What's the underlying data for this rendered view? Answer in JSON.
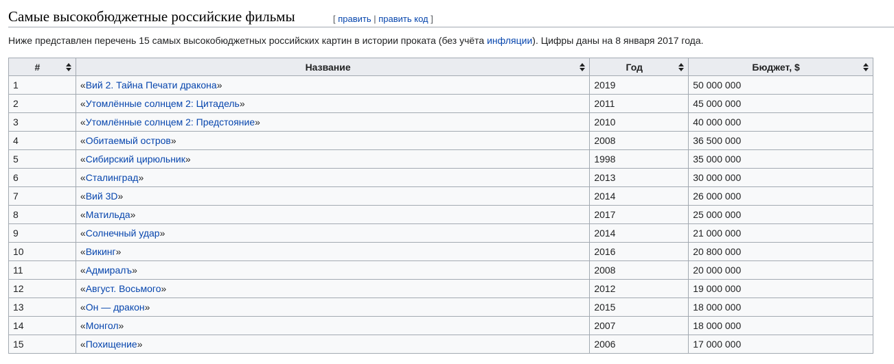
{
  "section": {
    "title": "Самые высокобюджетные российские фильмы",
    "edit_open": "[ ",
    "edit_link": "править",
    "edit_sep": " | ",
    "edit_code_link": "править код",
    "edit_close": " ]"
  },
  "intro": {
    "text_before": "Ниже представлен перечень 15 самых высокобюджетных российских картин в истории проката (без учёта ",
    "link": "инфляции",
    "text_after": "). Цифры даны на 8 января 2017 года."
  },
  "table": {
    "columns": [
      "#",
      "Название",
      "Год",
      "Бюджет, $"
    ],
    "quote_open": "«",
    "quote_close": "»",
    "rows": [
      {
        "num": "1",
        "title": "Вий 2. Тайна Печати дракона",
        "year": "2019",
        "budget": "50 000 000"
      },
      {
        "num": "2",
        "title": "Утомлённые солнцем 2: Цитадель",
        "year": "2011",
        "budget": "45 000 000"
      },
      {
        "num": "3",
        "title": "Утомлённые солнцем 2: Предстояние",
        "year": "2010",
        "budget": "40 000 000"
      },
      {
        "num": "4",
        "title": "Обитаемый остров",
        "year": "2008",
        "budget": "36 500 000"
      },
      {
        "num": "5",
        "title": "Сибирский цирюльник",
        "year": "1998",
        "budget": "35 000 000"
      },
      {
        "num": "6",
        "title": "Сталинград",
        "year": "2013",
        "budget": "30 000 000"
      },
      {
        "num": "7",
        "title": "Вий 3D",
        "year": "2014",
        "budget": "26 000 000"
      },
      {
        "num": "8",
        "title": "Матильда",
        "year": "2017",
        "budget": "25 000 000"
      },
      {
        "num": "9",
        "title": "Солнечный удар",
        "year": "2014",
        "budget": "21 000 000"
      },
      {
        "num": "10",
        "title": "Викинг",
        "year": "2016",
        "budget": "20 800 000"
      },
      {
        "num": "11",
        "title": "Адмиралъ",
        "year": "2008",
        "budget": "20 000 000"
      },
      {
        "num": "12",
        "title": "Август. Восьмого",
        "year": "2012",
        "budget": "19 000 000"
      },
      {
        "num": "13",
        "title": "Он — дракон",
        "year": "2015",
        "budget": "18 000 000"
      },
      {
        "num": "14",
        "title": "Монгол",
        "year": "2007",
        "budget": "18 000 000"
      },
      {
        "num": "15",
        "title": "Похищение",
        "year": "2006",
        "budget": "17 000 000"
      }
    ]
  },
  "colors": {
    "link": "#0645ad",
    "header_bg": "#eaecf0",
    "cell_bg": "#f8f9fa",
    "border": "#a2a9b1"
  },
  "icons": {
    "sort": "sort-up-down-icon"
  }
}
